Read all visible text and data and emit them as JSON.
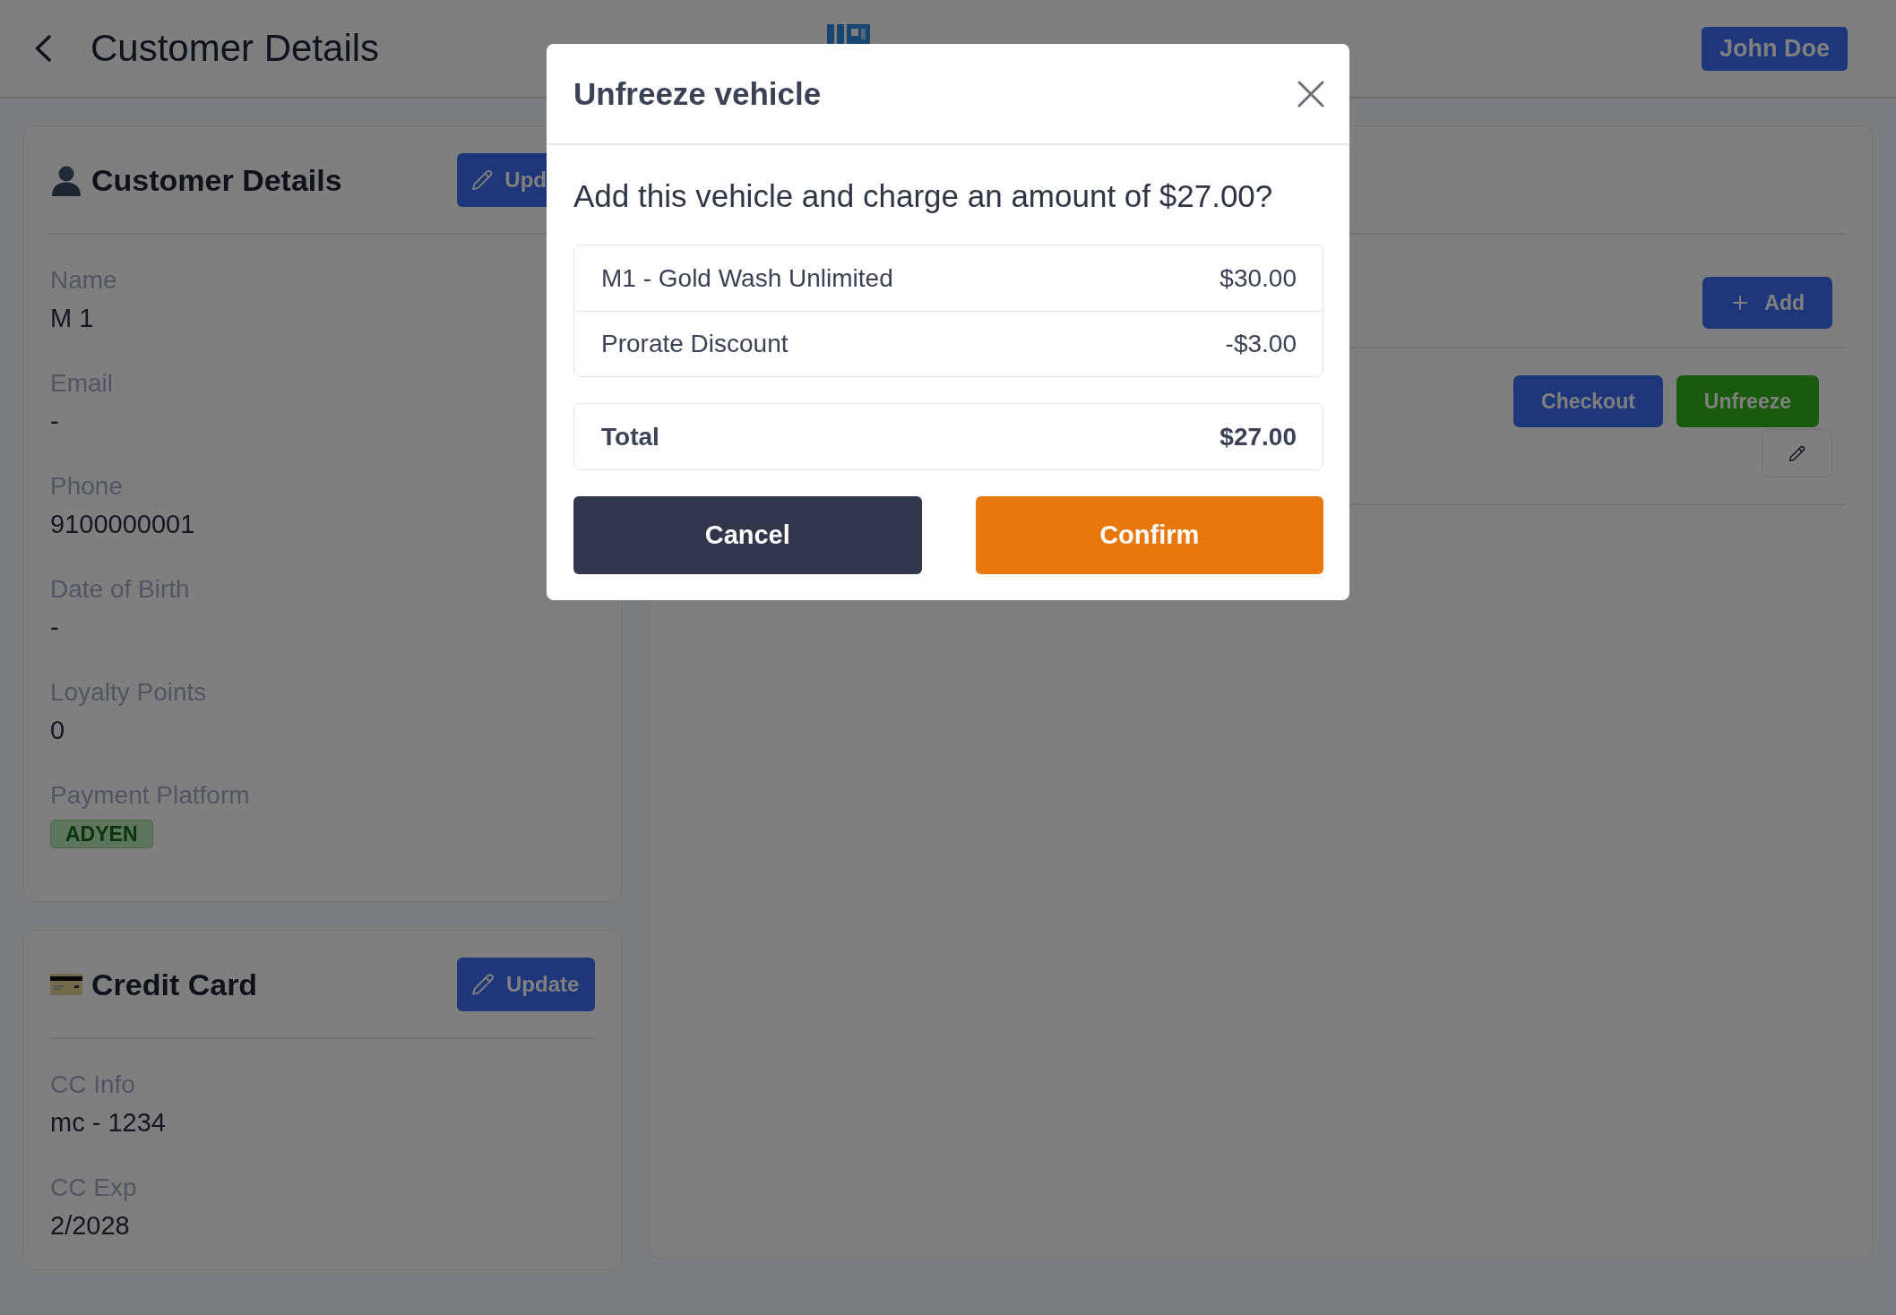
{
  "header": {
    "title": "Customer Details",
    "user_button": "John Doe"
  },
  "customer_card": {
    "title": "Customer Details",
    "update_button": "Upd",
    "fields": [
      {
        "kind": "text",
        "label": "Name",
        "value": "M 1"
      },
      {
        "kind": "text",
        "label": "Email",
        "value": "-"
      },
      {
        "kind": "text",
        "label": "Phone",
        "value": "9100000001"
      },
      {
        "kind": "text",
        "label": "Date of Birth",
        "value": "-"
      },
      {
        "kind": "text",
        "label": "Loyalty Points",
        "value": "0"
      },
      {
        "kind": "badge",
        "label": "Payment Platform",
        "value": "ADYEN"
      }
    ]
  },
  "credit_card": {
    "title": "Credit Card",
    "update_button": "Update",
    "fields": [
      {
        "kind": "text",
        "label": "CC Info",
        "value": "mc - 1234"
      },
      {
        "kind": "text",
        "label": "CC Exp",
        "value": "2/2028"
      }
    ]
  },
  "vehicles_panel": {
    "add_button": "Add",
    "vehicle": {
      "checkout_button": "Checkout",
      "unfreeze_button": "Unfreeze"
    }
  },
  "dialog": {
    "title": "Unfreeze vehicle",
    "question": "Add this vehicle and charge an amount of $27.00?",
    "items": [
      {
        "name": "M1 - Gold Wash Unlimited",
        "amount": "$30.00"
      },
      {
        "name": "Prorate Discount",
        "amount": "-$3.00"
      }
    ],
    "total": {
      "label": "Total",
      "amount": "$27.00"
    },
    "buttons": {
      "cancel": "Cancel",
      "confirm": "Confirm"
    }
  }
}
